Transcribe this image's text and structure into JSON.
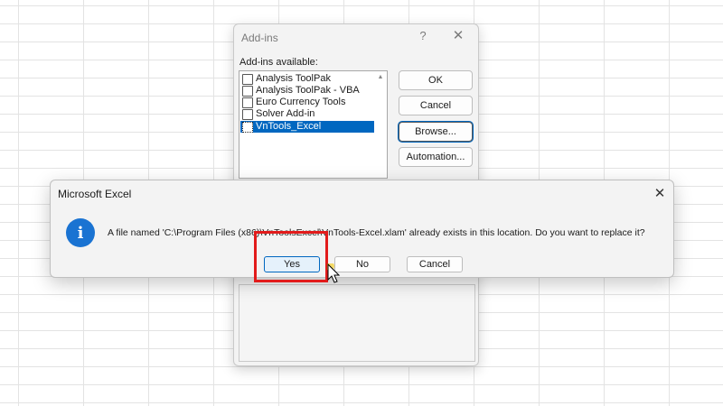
{
  "addins_dialog": {
    "title": "Add-ins",
    "help_glyph": "?",
    "close_glyph": "✕",
    "list_label": "Add-ins available:",
    "items": [
      {
        "label": "Analysis ToolPak",
        "checked": false,
        "selected": false
      },
      {
        "label": "Analysis ToolPak - VBA",
        "checked": false,
        "selected": false
      },
      {
        "label": "Euro Currency Tools",
        "checked": false,
        "selected": false
      },
      {
        "label": "Solver Add-in",
        "checked": false,
        "selected": false
      },
      {
        "label": "VnTools_Excel",
        "checked": false,
        "selected": true
      }
    ],
    "buttons": {
      "ok": "OK",
      "cancel": "Cancel",
      "browse": "Browse...",
      "automation": "Automation..."
    }
  },
  "message_box": {
    "title": "Microsoft Excel",
    "close_glyph": "✕",
    "icon": "info-icon",
    "icon_glyph": "i",
    "message": "A file named 'C:\\Program Files (x86)\\VnToolsExcel\\VnTools-Excel.xlam' already exists in this location. Do you want to replace it?",
    "buttons": {
      "yes": "Yes",
      "no": "No",
      "cancel": "Cancel"
    }
  },
  "colors": {
    "accent": "#0067c0",
    "info_icon": "#1a73d2",
    "highlight": "#e21b1b"
  }
}
